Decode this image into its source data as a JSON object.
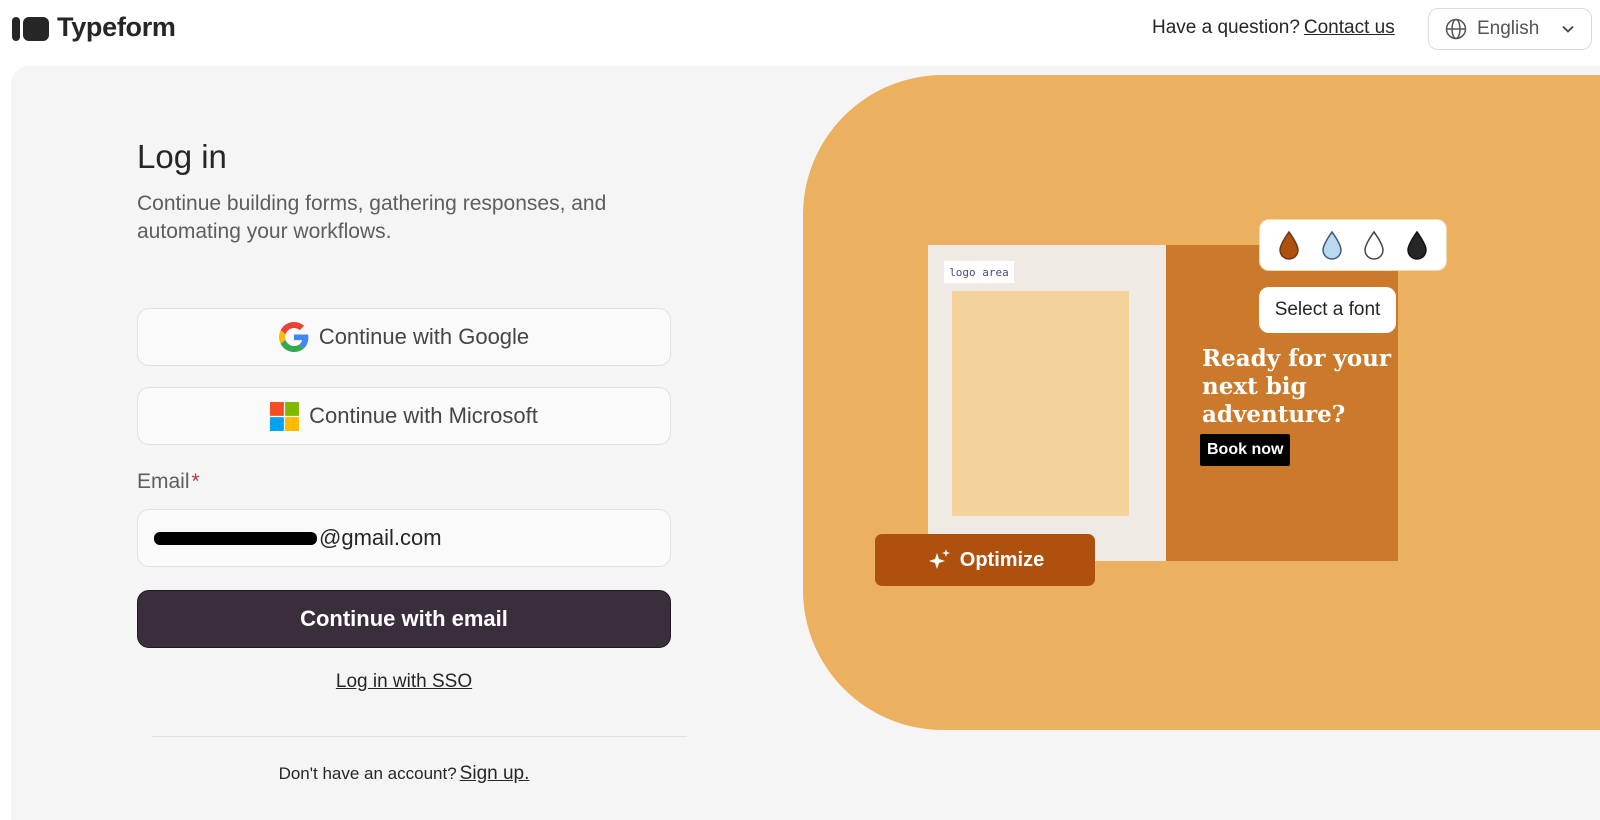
{
  "header": {
    "brand": "Typeform",
    "help_text": "Have a question?",
    "contact_link": "Contact us",
    "language": "English"
  },
  "login": {
    "title": "Log in",
    "subtitle": "Continue building forms, gathering responses, and automating your workflows.",
    "google_button": "Continue with Google",
    "microsoft_button": "Continue with Microsoft",
    "email_label": "Email",
    "required_mark": "*",
    "email_value": "@gmail.com",
    "email_button": "Continue with email",
    "sso_link": "Log in with SSO",
    "signup_prompt": "Don't have an account?",
    "signup_link": "Sign up."
  },
  "illustration": {
    "logo_area": "logo area",
    "headline": "Ready for your next big adventure?",
    "cta": "Book now",
    "font_button": "Select a font",
    "optimize_button": "Optimize",
    "color_swatches": [
      "#ae510e",
      "#b9d9f0",
      "#ffffff",
      "#262627"
    ]
  },
  "colors": {
    "primary_button": "#3a2e3c",
    "illustration_bg": "#ebb160",
    "accent": "#ae510e"
  }
}
